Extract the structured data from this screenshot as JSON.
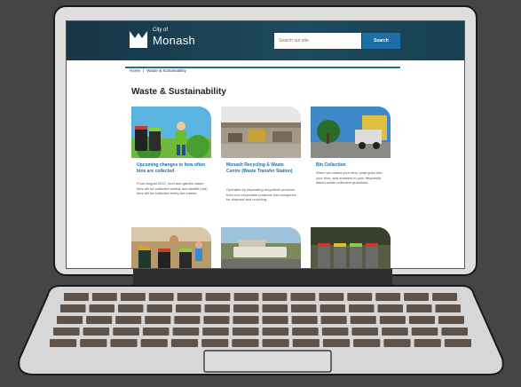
{
  "header": {
    "city_label": "City of",
    "city_name": "Monash",
    "search_placeholder": "Search our site",
    "search_button": "Search"
  },
  "breadcrumb": {
    "home": "Home",
    "separator": "/",
    "current": "Waste & Sustainability"
  },
  "page_title": "Waste & Sustainability",
  "cards": [
    {
      "title": "Upcoming changes to how often bins are collected",
      "description": "From August 2022, food and garden waste bins will be collected weekly and landfill (red) bins will be collected every two weeks."
    },
    {
      "title": "Monash Recycling & Waste Centre (Waste Transfer Station)",
      "description": "Operates by separating recyclable products from non-recyclable products into categories for disposal and recycling."
    },
    {
      "title": "Bin Collection",
      "description": "When we collect your bins, what goes into your bins, and answers to your frequently asked waste collection questions."
    }
  ],
  "colors": {
    "header": "#1e4a5e",
    "link": "#1d6fa5",
    "background": "#454545"
  }
}
